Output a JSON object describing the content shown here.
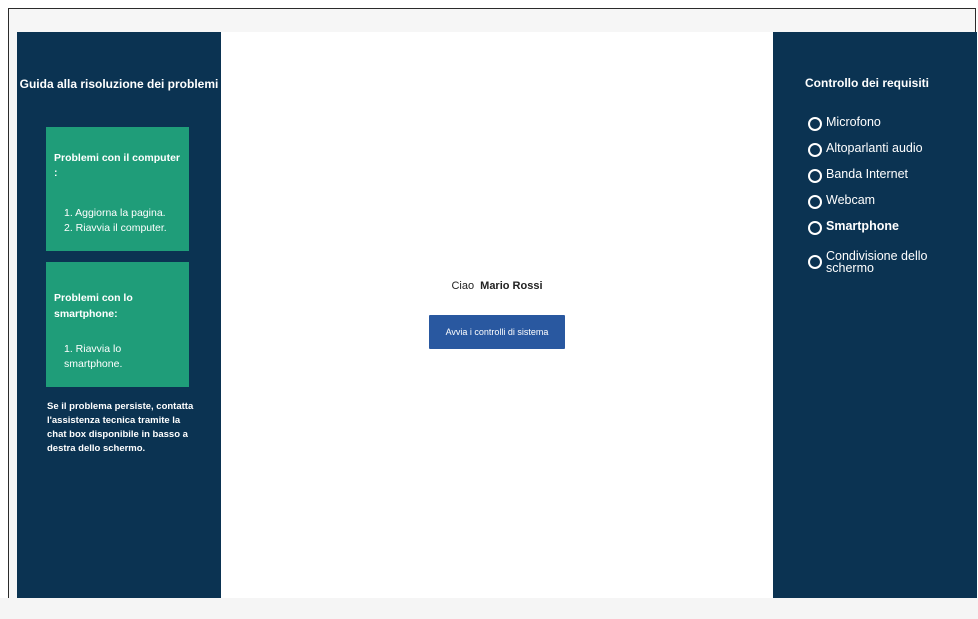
{
  "troubleshooting": {
    "title": "Guida alla risoluzione dei problemi",
    "computer": {
      "title": "Problemi con il computer :",
      "steps": [
        "1.  Aggiorna la pagina.",
        "2.  Riavvia il computer."
      ]
    },
    "smartphone": {
      "title": "Problemi con lo smartphone:",
      "steps": [
        "1.  Riavvia lo smartphone."
      ]
    },
    "note": "Se il problema persiste, contatta l'assistenza tecnica tramite la chat box disponibile in basso a destra dello schermo."
  },
  "main": {
    "greeting_prefix": "Ciao",
    "user_name": "Mario Rossi",
    "start_button_label": "Avvia i controlli di sistema"
  },
  "requirements": {
    "title": "Controllo dei requisiti",
    "items": [
      {
        "label": "Microfono",
        "icon": "circle-icon"
      },
      {
        "label": "Altoparlanti audio",
        "icon": "circle-icon"
      },
      {
        "label": "Banda Internet",
        "icon": "circle-icon"
      },
      {
        "label": "Webcam",
        "icon": "circle-icon"
      },
      {
        "label": "Smartphone",
        "icon": "circle-icon"
      },
      {
        "label": "Condivisione dello schermo",
        "icon": "circle-icon"
      }
    ]
  },
  "colors": {
    "panel": "#0b3352",
    "card": "#1f9d79",
    "button": "#2958a0"
  }
}
